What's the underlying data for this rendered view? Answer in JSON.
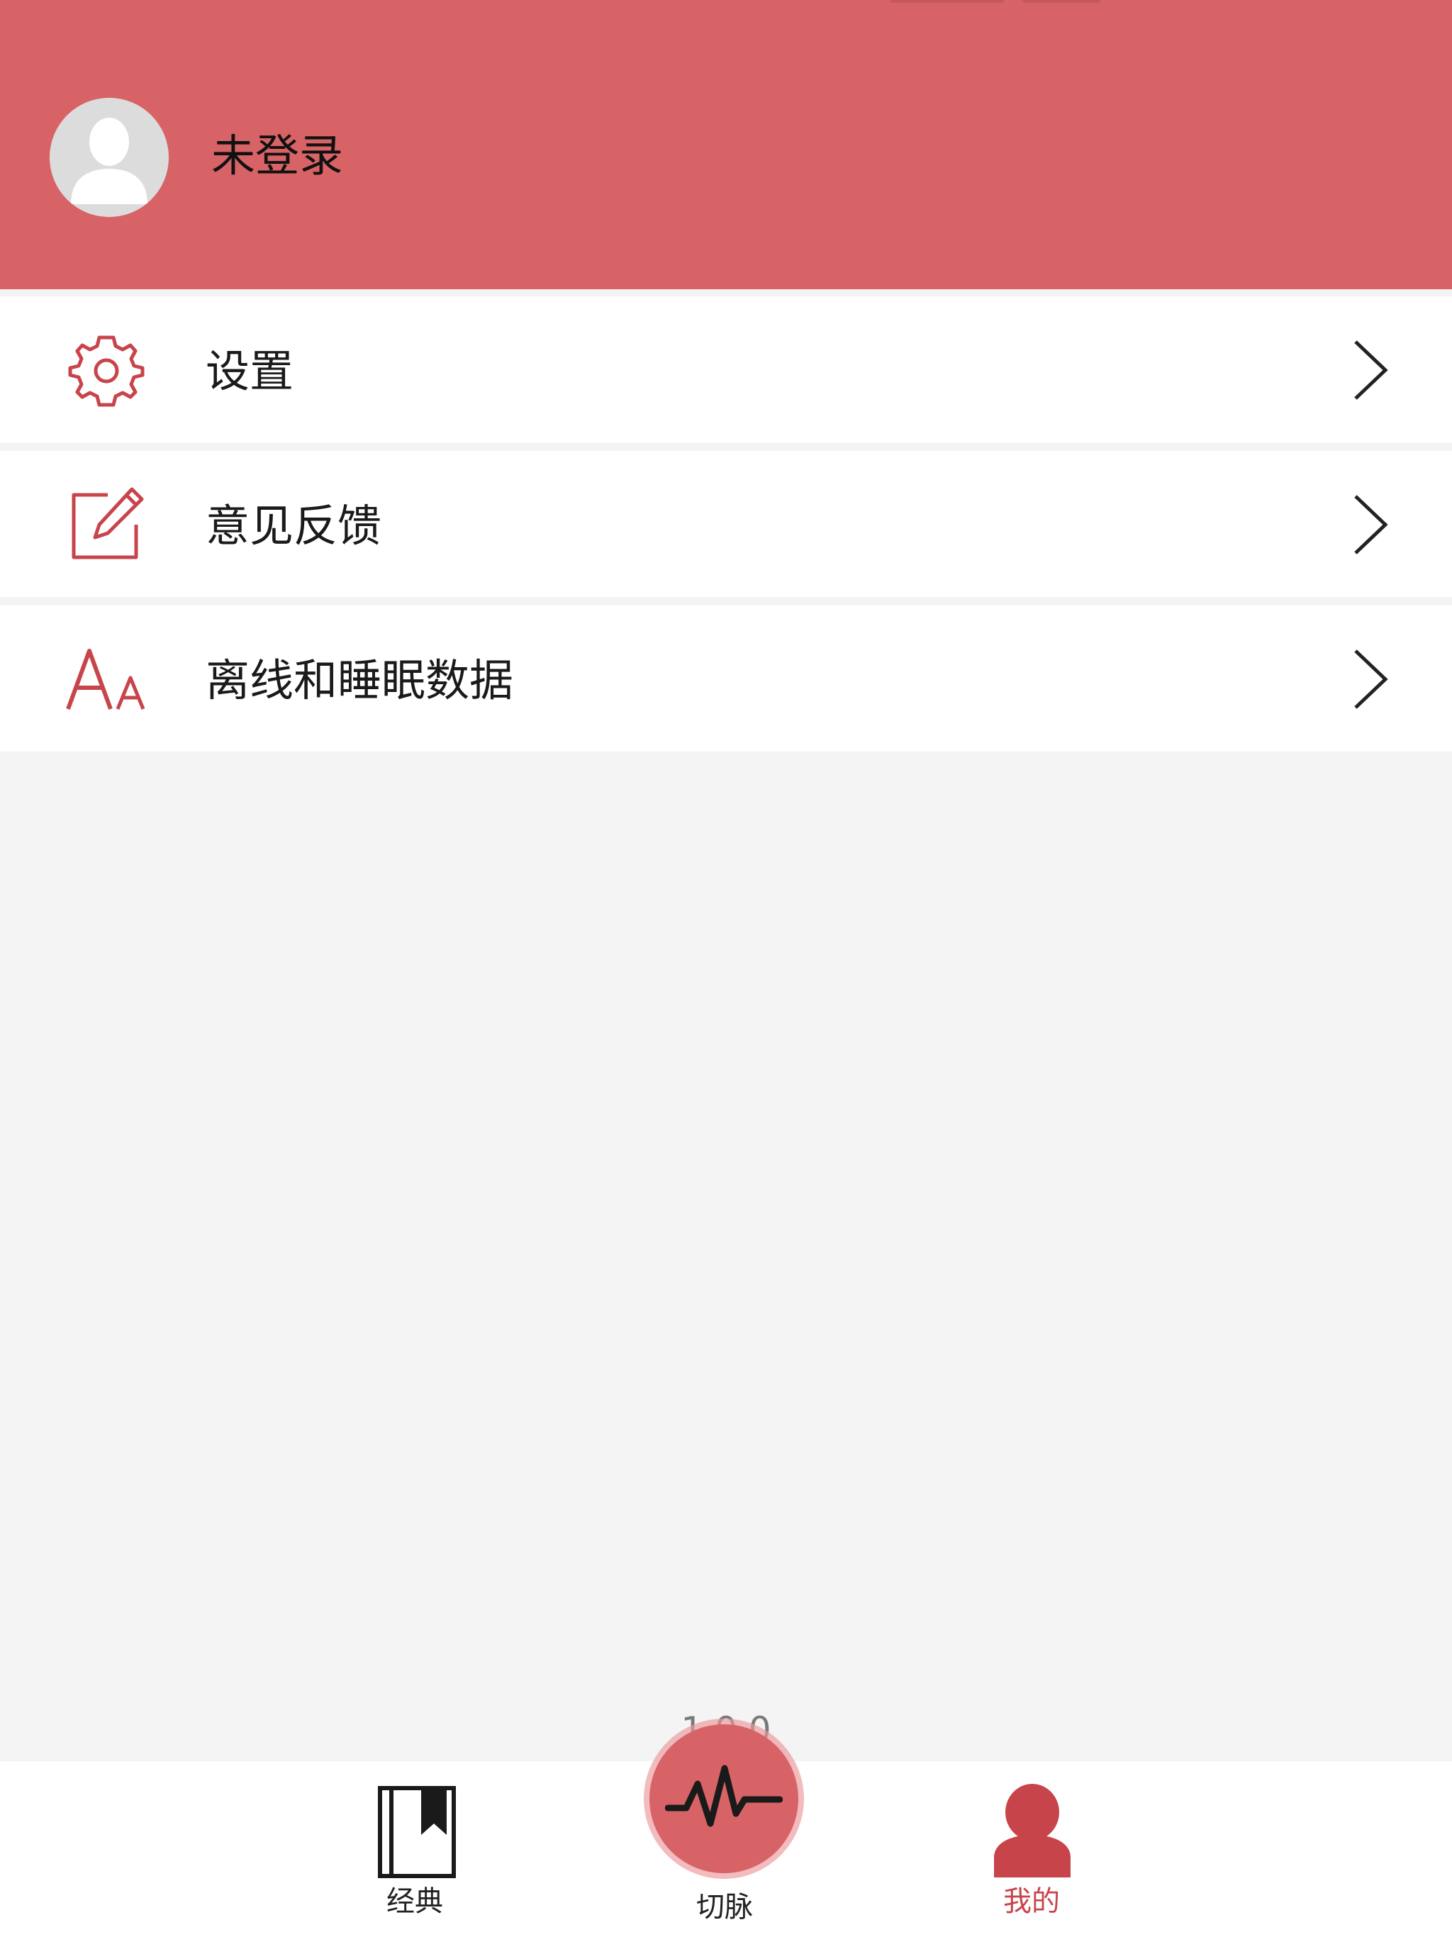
{
  "header": {
    "login_status": "未登录",
    "background_color": "#d86366"
  },
  "menu": {
    "items": [
      {
        "label": "设置",
        "icon": "gear-icon"
      },
      {
        "label": "意见反馈",
        "icon": "edit-icon"
      },
      {
        "label": "离线和睡眠数据",
        "icon": "font-size-icon"
      }
    ],
    "accent_color": "#c8444b"
  },
  "footer": {
    "version": "1.0.0"
  },
  "tabbar": {
    "tabs": [
      {
        "label": "经典",
        "icon": "book-icon",
        "active": false
      },
      {
        "label": "切脉",
        "icon": "pulse-icon",
        "active": false
      },
      {
        "label": "我的",
        "icon": "user-icon",
        "active": true
      }
    ],
    "active_color": "#c8444b"
  }
}
